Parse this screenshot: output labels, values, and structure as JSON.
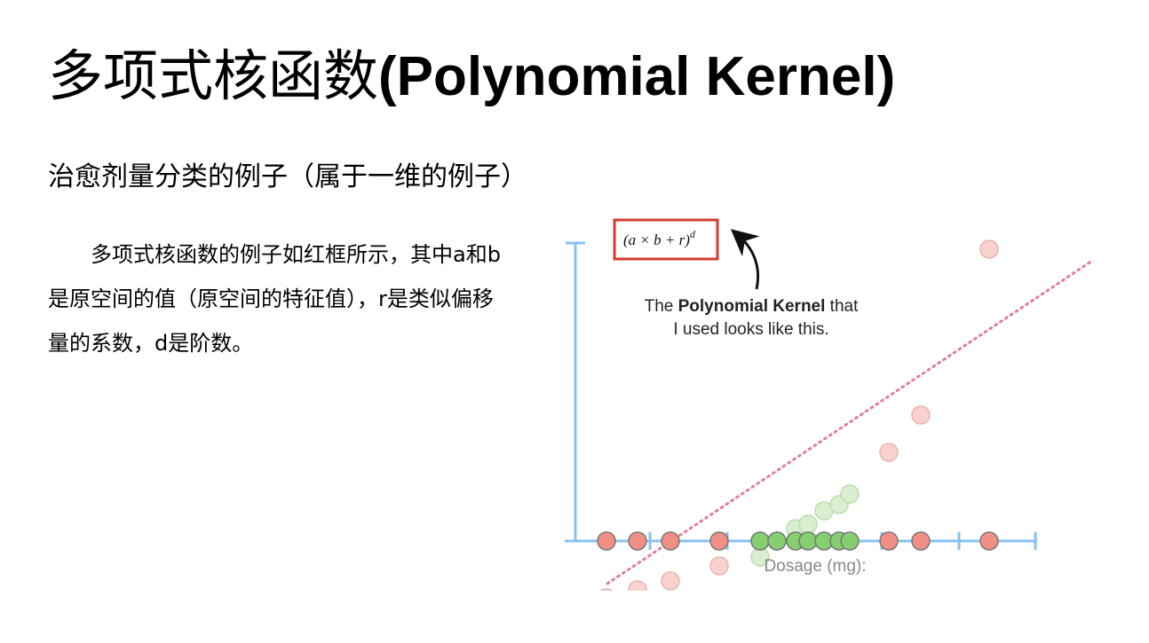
{
  "slide": {
    "title_cn": "多项式核函数",
    "title_en": "(Polynomial Kernel)",
    "subtitle": "治愈剂量分类的例子（属于一维的例子）",
    "body": "多项式核函数的例子如红框所示，其中a和b是原空间的值（原空间的特征值），r是类似偏移量的系数，d是阶数。"
  },
  "figure": {
    "formula_main": "(a × b + r)",
    "formula_exp": "d",
    "callout_before": "The ",
    "callout_bold": "Polynomial Kernel",
    "callout_after": " that",
    "callout_line2": "I used looks like this.",
    "axis_label": "Dosage (mg):",
    "colors": {
      "axis": "#87c1ee",
      "red_point": "#f08f85",
      "green_point": "#85cf6e",
      "point_outline": "#777777",
      "faded_red": "#f9d2cd",
      "faded_green": "#d9efcf",
      "box_border": "#d63b2f",
      "dotted_line": "#df7f9a"
    },
    "points_1d": [
      {
        "class": "red"
      },
      {
        "class": "red"
      },
      {
        "class": "red"
      },
      {
        "class": "red"
      },
      {
        "class": "green"
      },
      {
        "class": "green"
      },
      {
        "class": "green"
      },
      {
        "class": "green"
      },
      {
        "class": "green"
      },
      {
        "class": "green"
      },
      {
        "class": "green"
      },
      {
        "class": "red"
      },
      {
        "class": "red"
      },
      {
        "class": "red"
      }
    ]
  }
}
